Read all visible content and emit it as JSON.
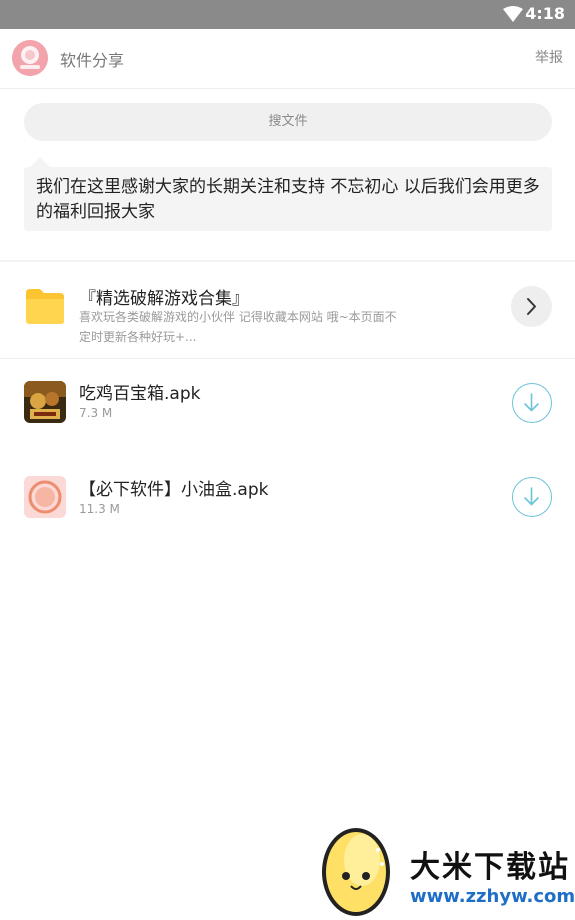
{
  "status_bar": {
    "time": "4:18",
    "wifi_icon": "wifi-icon"
  },
  "header": {
    "title": "软件分享",
    "report": "举报",
    "avatar_icon": "logo-avatar-icon"
  },
  "search": {
    "placeholder": "搜文件"
  },
  "notice": {
    "text": "我们在这里感谢大家的长期关注和支持 不忘初心 以后我们会用更多的福利回报大家"
  },
  "items": [
    {
      "type": "folder",
      "title": "『精选破解游戏合集』",
      "subtitle": "喜欢玩各类破解游戏的小伙伴 记得收藏本网站 哦~本页面不定时更新各种好玩+...",
      "icon": "folder-icon",
      "action_icon": "chevron-right-icon"
    },
    {
      "type": "file",
      "title": "吃鸡百宝箱.apk",
      "size": "7.3 M",
      "icon": "game-app-icon",
      "action_icon": "download-icon"
    },
    {
      "type": "file",
      "title": "【必下软件】小油盒.apk",
      "size": "11.3 M",
      "icon": "youhe-app-icon",
      "action_icon": "download-icon"
    }
  ],
  "watermark": {
    "name": "大米下载站",
    "url": "www.zzhyw.com"
  },
  "colors": {
    "accent": "#6cc4d8",
    "folder": "#ffd54f",
    "status_bar": "#8a8a8a"
  }
}
